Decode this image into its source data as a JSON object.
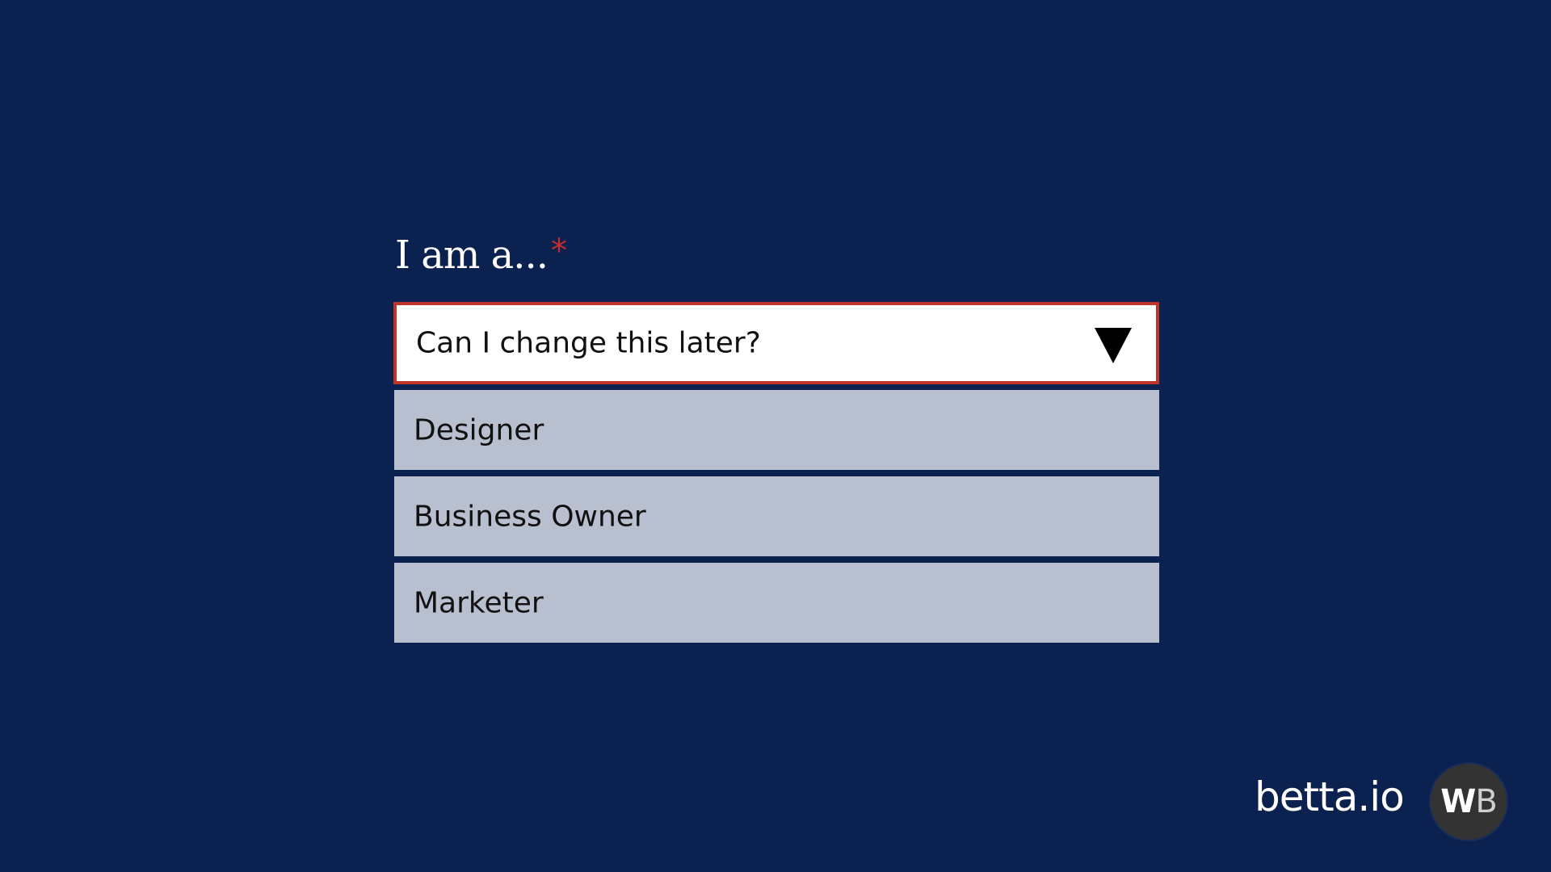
{
  "form": {
    "label": "I am a...",
    "required_marker": "*",
    "select": {
      "value": "Can I change this later?",
      "icon": "chevron-down-icon",
      "error_border_color": "#c03529"
    },
    "options": [
      {
        "label": "Designer"
      },
      {
        "label": "Business Owner"
      },
      {
        "label": "Marketer"
      }
    ]
  },
  "footer": {
    "brand": "betta.io",
    "avatar": {
      "letter1": "W",
      "letter2": "B"
    }
  },
  "colors": {
    "background": "#0b2150",
    "option_bg": "#b8bfcf",
    "required": "#c62d2d"
  }
}
